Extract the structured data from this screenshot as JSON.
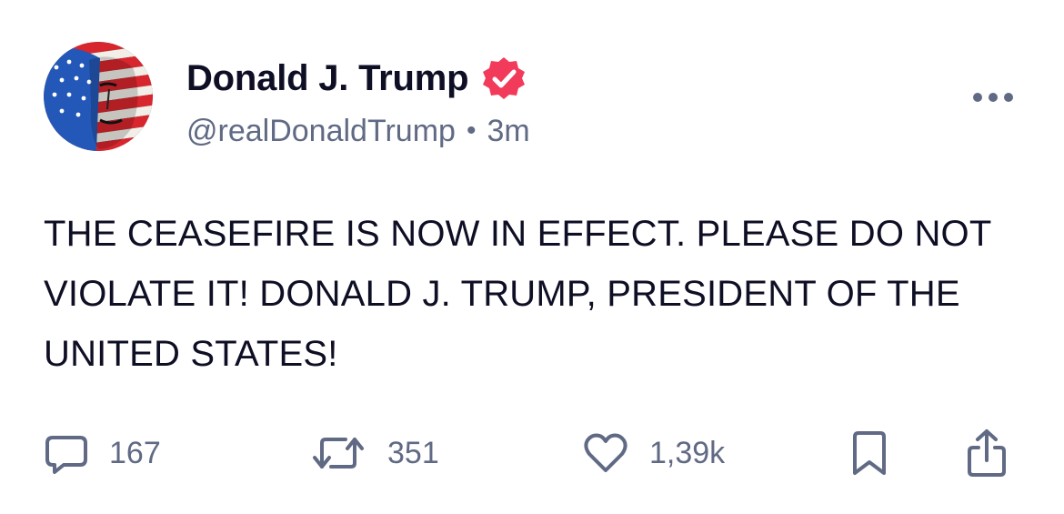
{
  "author": {
    "display_name": "Donald J. Trump",
    "handle": "@realDonaldTrump",
    "separator": "•",
    "time_ago": "3m",
    "verified_color": "#f23a5a",
    "avatar_icon": "avatar-image"
  },
  "post": {
    "text": "THE CEASEFIRE IS NOW IN EFFECT. PLEASE DO NOT VIOLATE IT! DONALD J. TRUMP, PRESIDENT OF THE UNITED STATES!"
  },
  "actions": {
    "reply_count": "167",
    "restruth_count": "351",
    "like_count": "1,39k",
    "icons": [
      "reply-icon",
      "restruth-icon",
      "heart-icon",
      "bookmark-icon",
      "share-icon"
    ]
  },
  "colors": {
    "text": "#0e0f24",
    "muted": "#606a84",
    "accent": "#f23a5a"
  }
}
